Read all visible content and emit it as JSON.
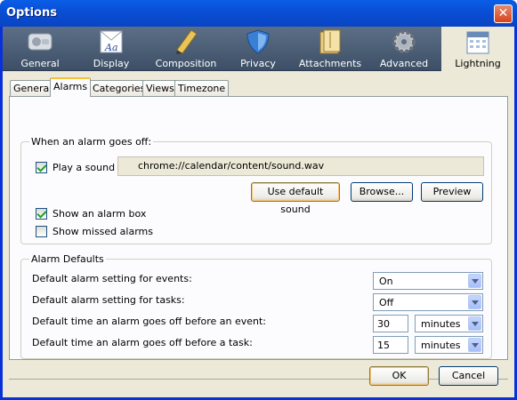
{
  "window": {
    "title": "Options",
    "close_glyph": "✕"
  },
  "panes": [
    {
      "label": "General",
      "icon": "switch-icon"
    },
    {
      "label": "Display",
      "icon": "display-icon"
    },
    {
      "label": "Composition",
      "icon": "pencil-icon"
    },
    {
      "label": "Privacy",
      "icon": "shield-icon"
    },
    {
      "label": "Attachments",
      "icon": "folder-icon"
    },
    {
      "label": "Advanced",
      "icon": "gear-icon"
    },
    {
      "label": "Lightning",
      "icon": "calendar-icon",
      "selected": true
    }
  ],
  "tabs": [
    {
      "label": "General"
    },
    {
      "label": "Alarms",
      "active": true
    },
    {
      "label": "Categories"
    },
    {
      "label": "Views"
    },
    {
      "label": "Timezone"
    }
  ],
  "alarm_goes_off": {
    "title": "When an alarm goes off:",
    "play_sound": {
      "label": "Play a sound",
      "checked": true
    },
    "sound_path": "chrome://calendar/content/sound.wav",
    "use_default_button": "Use default sound",
    "browse_button": "Browse...",
    "preview_button": "Preview",
    "show_alarm_box": {
      "label": "Show an alarm box",
      "checked": true
    },
    "show_missed": {
      "label": "Show missed alarms",
      "checked": false
    }
  },
  "alarm_defaults": {
    "title": "Alarm Defaults",
    "events_label": "Default alarm setting for events:",
    "events_value": "On",
    "tasks_label": "Default alarm setting for tasks:",
    "tasks_value": "Off",
    "event_time_label": "Default time an alarm goes off before an event:",
    "event_time_value": "30",
    "event_time_unit": "minutes",
    "task_time_label": "Default time an alarm goes off before a task:",
    "task_time_value": "15",
    "task_time_unit": "minutes"
  },
  "footer": {
    "ok": "OK",
    "cancel": "Cancel"
  }
}
